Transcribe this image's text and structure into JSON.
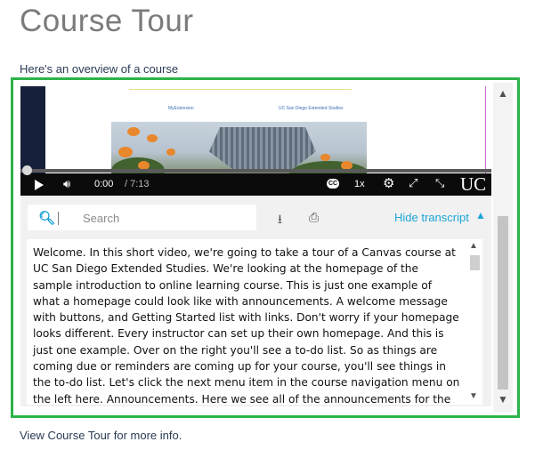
{
  "page": {
    "title": "Course Tour",
    "subtitle": "Here's an overview of a course",
    "footer": "View Course Tour for more info."
  },
  "video": {
    "link1": "MyExtension",
    "link2": "UC San Diego Extended Studies",
    "current_time": "0:00",
    "duration": "/ 7:13",
    "speed": "1x",
    "cc_label": "CC",
    "logo_text": "UC",
    "progress": 0.0
  },
  "transcript": {
    "search_placeholder": "Search",
    "hide_label": "Hide transcript",
    "text": "Welcome. In this short video, we're going to take a tour of a Canvas course at UC San Diego Extended Studies. We're looking at the homepage of the sample introduction to online learning course. This is just one example of what a homepage could look like with announcements. A welcome message with buttons, and Getting Started list with links. Don't worry if your homepage looks different. Every instructor can set up their own homepage. And this is just one example. Over on the right you'll see a to-do list. So as things are coming due or reminders are coming up for your course, you'll see things in the to-do list. Let's click the next menu item in the course navigation menu on the left here. Announcements. Here we see all of the announcements for the course in reverse chronological order. There will be blue unread dots next to the announcements. You"
  },
  "colors": {
    "frame_border": "#2db34a",
    "accent": "#1ca6d6",
    "title_gray": "#7b7b7b"
  },
  "icons": [
    "play-icon",
    "volume-icon",
    "cc-icon",
    "gear-icon",
    "expand-icon",
    "fullscreen-icon",
    "search-icon",
    "download-icon",
    "print-icon",
    "chevron-up-icon",
    "chevron-down-icon"
  ]
}
